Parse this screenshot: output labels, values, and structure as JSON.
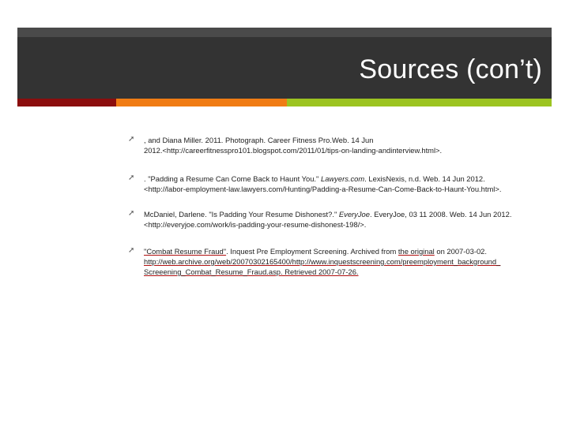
{
  "slide": {
    "title": "Sources (con’t)",
    "colors": {
      "header_band": "#333333",
      "top_strip": "#4a4a4a",
      "bar_red": "#8b0d0d",
      "bar_orange": "#f07c14",
      "bar_green": "#9cc421"
    }
  },
  "bullet_icon": "arrow-bullet-icon",
  "sources": [
    {
      "line1": ", and Diana Miller. 2011. Photograph. Career Fitness Pro.Web. 14 Jun",
      "line2": "2012.<http://careerfitnesspro101.blogspot.com/2011/01/tips-on-landing-andinterview.html>."
    },
    {
      "line1_pre": ". \"Padding a Resume Can Come Back to Haunt You.\" ",
      "line1_italic": "Lawyers.com",
      "line1_post": ". LexisNexis, n.d. Web. 14 Jun 2012.",
      "line2": "<http://labor-employment-law.lawyers.com/Hunting/Padding-a-Resume-Can-Come-Back-to-Haunt-You.html>."
    },
    {
      "line1_pre": "McDaniel, Darlene. \"Is Padding Your Resume Dishonest?.\" ",
      "line1_italic": "EveryJoe",
      "line1_post": ". EveryJoe, 03 11 2008. Web. 14 Jun 2012.",
      "line2": "<http://everyjoe.com/work/is-padding-your-resume-dishonest-198/>."
    },
    {
      "title_link": "\"Combat Resume Fraud\"",
      "line1_mid": ". Inquest Pre Employment Screening. Archived from ",
      "original_link": "the original",
      "line1_post": " on 2007-03-02.",
      "line2": "http://web.archive.org/web/20070302165400/http://www.inquestscreening.com/preemployment_background_",
      "line3": "Screeening_Combat_Resume_Fraud.asp",
      "line3_post": ". Retrieved 2007-07-26."
    }
  ]
}
